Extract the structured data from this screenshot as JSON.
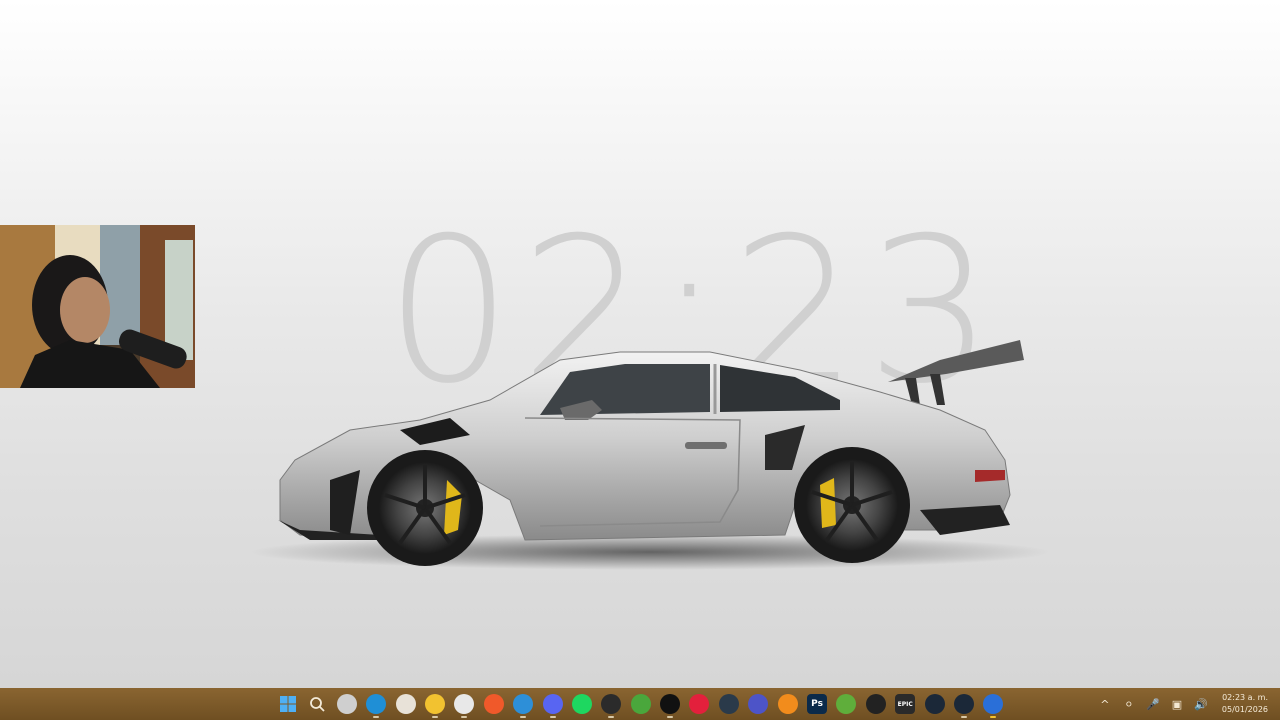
{
  "wallpaper": {
    "clock_text": "02:23"
  },
  "taskbar": {
    "apps": [
      {
        "name": "start-button",
        "glyph": "",
        "color": "#3aa0f0"
      },
      {
        "name": "search-button",
        "glyph": "",
        "color": "transparent"
      },
      {
        "name": "task-view-button",
        "glyph": "",
        "color": "#cfcfcf"
      },
      {
        "name": "edge-app",
        "glyph": "",
        "color": "#1f8fd6"
      },
      {
        "name": "store-app",
        "glyph": "",
        "color": "#e8e2d8"
      },
      {
        "name": "file-explorer-app",
        "glyph": "",
        "color": "#f2c230"
      },
      {
        "name": "chrome-app",
        "glyph": "",
        "color": "#e8e8e8"
      },
      {
        "name": "brave-app",
        "glyph": "",
        "color": "#f0592a"
      },
      {
        "name": "vscode-app",
        "glyph": "",
        "color": "#2d8fd8"
      },
      {
        "name": "discord-app",
        "glyph": "",
        "color": "#5865f2"
      },
      {
        "name": "spotify-app",
        "glyph": "",
        "color": "#1ed760"
      },
      {
        "name": "obs-app",
        "glyph": "",
        "color": "#2b2b2b"
      },
      {
        "name": "xbox-app",
        "glyph": "",
        "color": "#4aa73c"
      },
      {
        "name": "capcut-app",
        "glyph": "",
        "color": "#111111"
      },
      {
        "name": "opera-app",
        "glyph": "",
        "color": "#e3203c"
      },
      {
        "name": "davinci-app",
        "glyph": "",
        "color": "#2a3a4a"
      },
      {
        "name": "hoyoplay-app",
        "glyph": "",
        "color": "#4d54c8"
      },
      {
        "name": "blender-app",
        "glyph": "",
        "color": "#f28c1c"
      },
      {
        "name": "photoshop-app",
        "glyph": "Ps",
        "color": "#0b2a4a"
      },
      {
        "name": "minecraft-app",
        "glyph": "",
        "color": "#5fae3b"
      },
      {
        "name": "unity-app",
        "glyph": "",
        "color": "#222222"
      },
      {
        "name": "epic-games-app",
        "glyph": "EPIC",
        "color": "#2a2a2a"
      },
      {
        "name": "steam-app",
        "glyph": "",
        "color": "#1b2838"
      },
      {
        "name": "steam-app-2",
        "glyph": "",
        "color": "#1b2838"
      },
      {
        "name": "settings-app",
        "glyph": "",
        "color": "#2a6fd8"
      }
    ],
    "tray": {
      "chevron": "^",
      "time": "02:23 a. m.",
      "date": "05/01/2026"
    }
  }
}
